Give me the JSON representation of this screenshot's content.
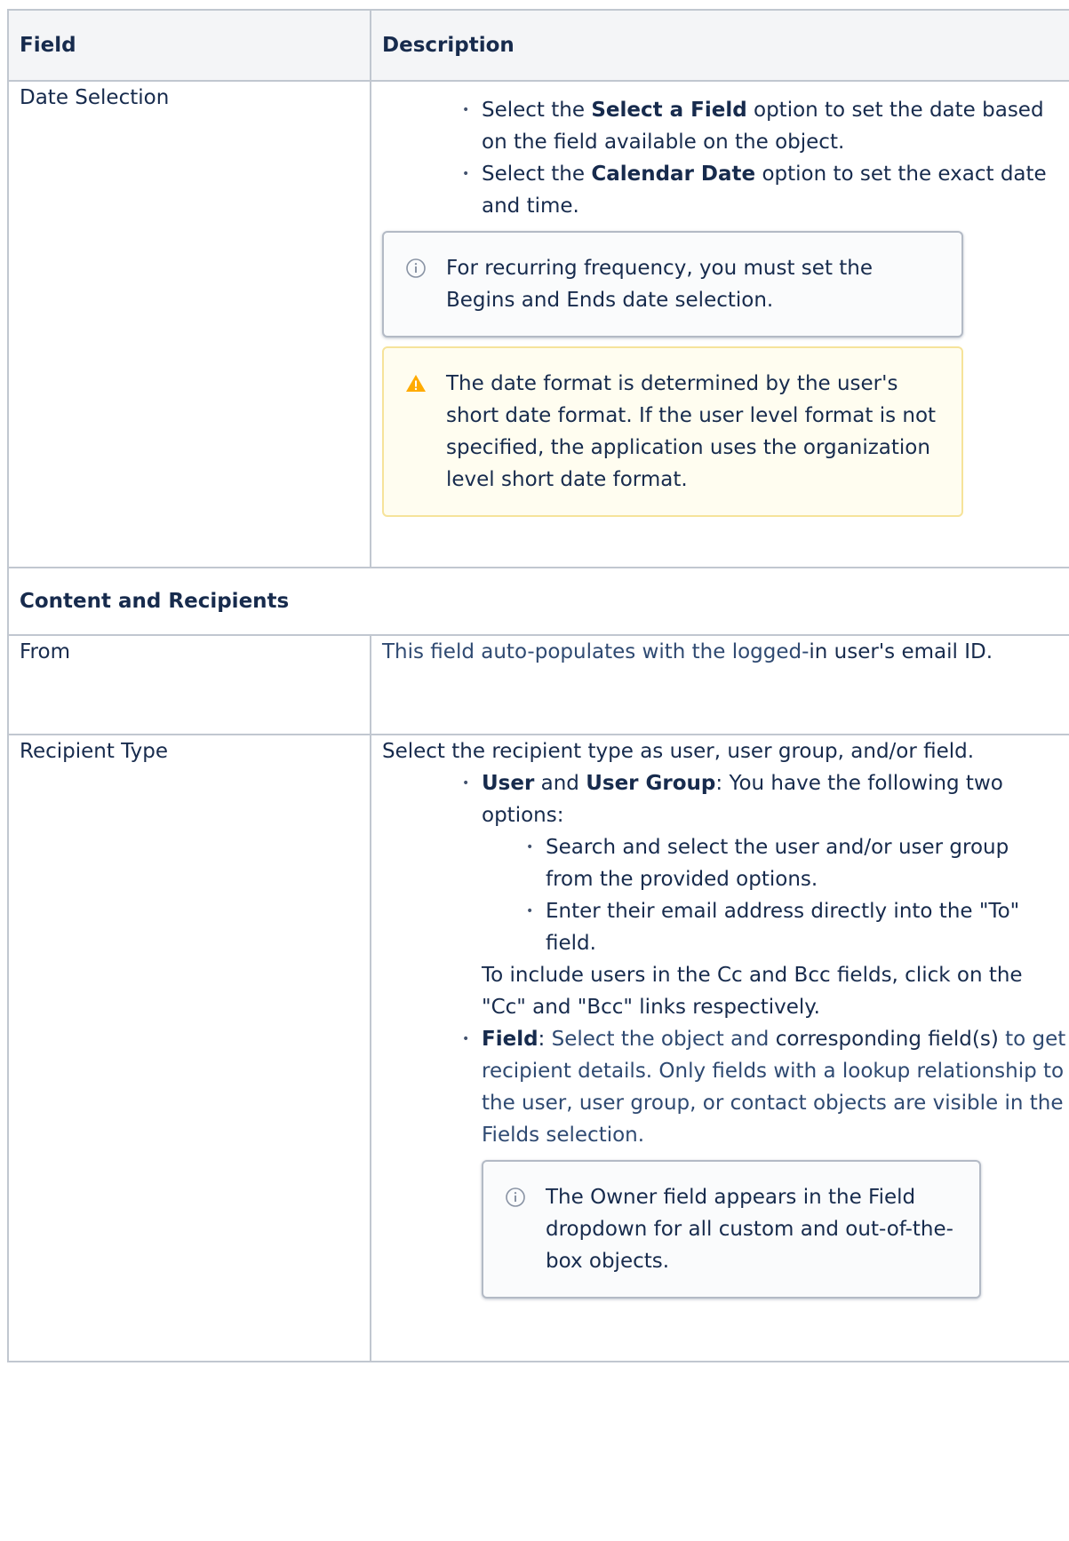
{
  "table": {
    "header": {
      "field": "Field",
      "description": "Description"
    },
    "date_selection": {
      "field": "Date Selection",
      "bullets": [
        {
          "pre": "Select the ",
          "bold": "Select a Field",
          "post": " option to set the date based on the field available on the object."
        },
        {
          "pre": "Select the ",
          "bold": "Calendar Date",
          "post": " option to set the exact date and time."
        }
      ],
      "info_note": "For recurring frequency, you must set the Begins and Ends date selection.",
      "warning_note": "The date format is determined by the user's short date format. If the user level format is not specified, the application uses the organization level short date format."
    },
    "section_heading": "Content and Recipients",
    "from": {
      "field": "From",
      "desc_link": "This field auto-populates with the logged-",
      "desc_rest": "in user's email ID."
    },
    "recipient_type": {
      "field": "Recipient Type",
      "intro": "Select the recipient type as user, user group, and/or field.",
      "user_bullet": {
        "bold1": "User",
        "mid": " and ",
        "bold2": "User Group",
        "rest": ": You have the following two options:",
        "sub": [
          "Search and select the user and/or user group from the provided options.",
          "Enter their email address directly into the \"To\" field."
        ],
        "after": "To include users in the Cc and Bcc fields, click on the \"Cc\" and \"Bcc\" links respectively."
      },
      "field_bullet": {
        "bold": "Field",
        "colon": ": ",
        "link1": "Select the object and",
        "mid": " corresponding field(s) ",
        "link2": "to get recipient details. Only fields with a lookup relationship to the user, user group, or contact objects are visible in the Fields selection."
      },
      "info_note": "The Owner field appears in the Field dropdown for all custom and out-of-the-box objects."
    }
  },
  "icons": {
    "info": "info-icon",
    "warning": "warning-icon"
  },
  "colors": {
    "border": "#c1c7d0",
    "header_bg": "#f4f5f7",
    "link": "#2f4a72",
    "warning_bg": "#fffdf0",
    "warning_border": "#f6e39a",
    "warning_icon": "#ffab00"
  }
}
